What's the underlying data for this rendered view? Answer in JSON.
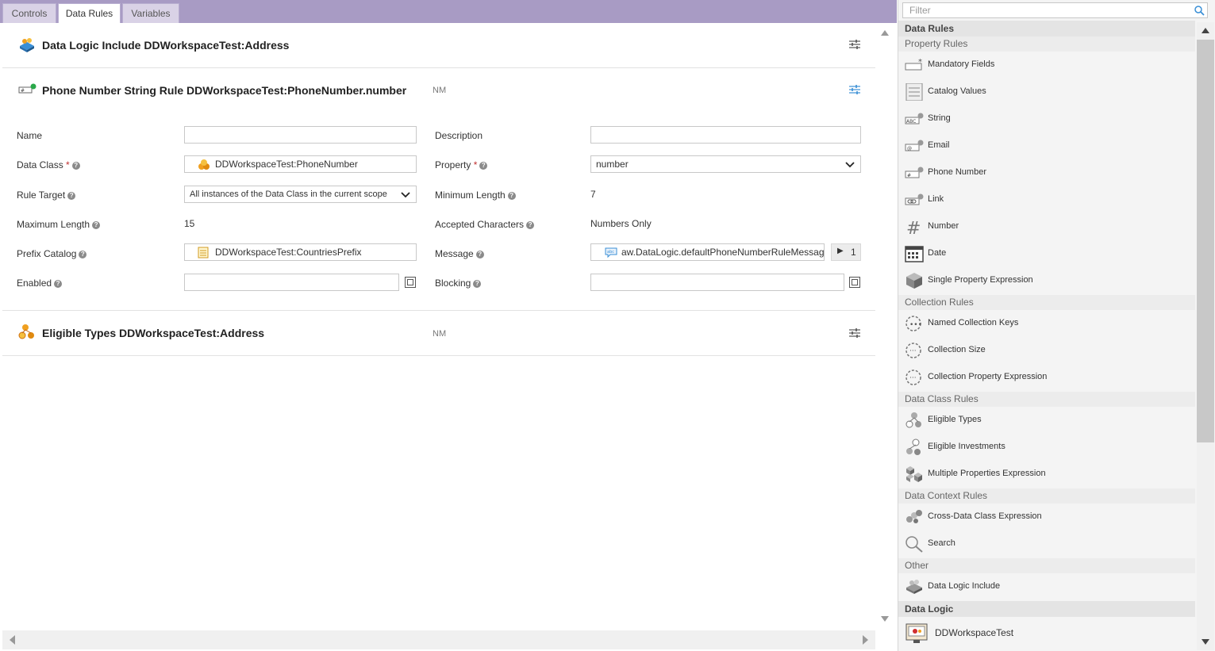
{
  "tabs": [
    {
      "label": "Controls",
      "active": false
    },
    {
      "label": "Data Rules",
      "active": true
    },
    {
      "label": "Variables",
      "active": false
    }
  ],
  "rules": {
    "include": {
      "title": "Data Logic Include DDWorkspaceTest:Address"
    },
    "phone": {
      "title": "Phone Number String Rule DDWorkspaceTest:PhoneNumber.number",
      "nm": "NM",
      "fields": {
        "name_label": "Name",
        "name_value": "",
        "description_label": "Description",
        "description_value": "",
        "data_class_label": "Data Class",
        "data_class_value": "DDWorkspaceTest:PhoneNumber",
        "property_label": "Property",
        "property_value": "number",
        "rule_target_label": "Rule Target",
        "rule_target_value": "All instances of the Data Class in the current scope",
        "min_length_label": "Minimum Length",
        "min_length_value": "7",
        "max_length_label": "Maximum Length",
        "max_length_value": "15",
        "accepted_chars_label": "Accepted Characters",
        "accepted_chars_value": "Numbers Only",
        "prefix_catalog_label": "Prefix Catalog",
        "prefix_catalog_value": "DDWorkspaceTest:CountriesPrefix",
        "message_label": "Message",
        "message_value": "aw.DataLogic.defaultPhoneNumberRuleMessage",
        "message_count": "1",
        "enabled_label": "Enabled",
        "enabled_value": "",
        "blocking_label": "Blocking",
        "blocking_value": "",
        "required_mark": "*"
      }
    },
    "eligible": {
      "title": "Eligible Types DDWorkspaceTest:Address",
      "nm": "NM"
    }
  },
  "palette": {
    "filter_placeholder": "Filter",
    "data_rules_header": "Data Rules",
    "property_rules_header": "Property Rules",
    "property_rules": [
      "Mandatory Fields",
      "Catalog Values",
      "String",
      "Email",
      "Phone Number",
      "Link",
      "Number",
      "Date",
      "Single Property Expression"
    ],
    "collection_rules_header": "Collection Rules",
    "collection_rules": [
      "Named Collection Keys",
      "Collection Size",
      "Collection Property Expression"
    ],
    "data_class_rules_header": "Data Class Rules",
    "data_class_rules": [
      "Eligible Types",
      "Eligible Investments",
      "Multiple Properties Expression"
    ],
    "data_context_rules_header": "Data Context Rules",
    "data_context_rules": [
      "Cross-Data Class Expression",
      "Search"
    ],
    "other_header": "Other",
    "other": [
      "Data Logic Include"
    ],
    "data_logic_header": "Data Logic",
    "data_logic": [
      "DDWorkspaceTest"
    ]
  },
  "colors": {
    "tabbar": "#a89bc4",
    "accent_icon": "#f0a020",
    "green_check": "#2aa84a",
    "blue_tune": "#3a8fd6"
  }
}
